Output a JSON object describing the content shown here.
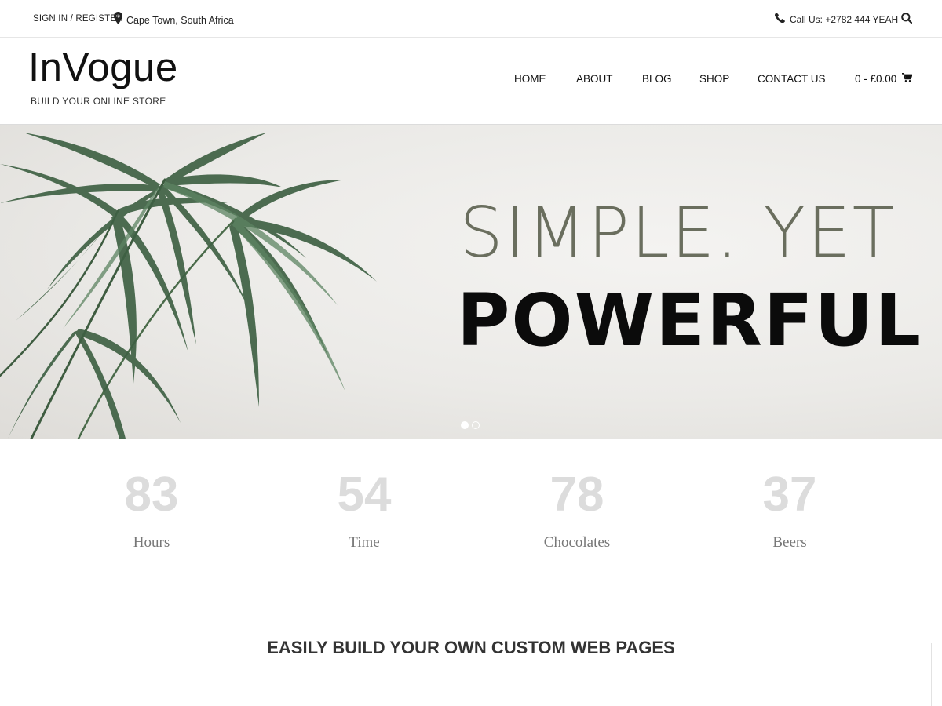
{
  "topbar": {
    "signin_label": "SIGN IN / REGISTER",
    "location": "Cape Town, South Africa",
    "call": "Call Us: +2782 444 YEAH"
  },
  "header": {
    "logo": "InVogue",
    "tagline": "BUILD YOUR ONLINE STORE",
    "nav": [
      "HOME",
      "ABOUT",
      "BLOG",
      "SHOP",
      "CONTACT US"
    ],
    "cart": "0 - £0.00"
  },
  "hero": {
    "line1": "SIMPLE. YET",
    "line2": "POWERFUL",
    "slides": 2,
    "active_slide": 1
  },
  "stats": [
    {
      "value": "83",
      "label": "Hours"
    },
    {
      "value": "54",
      "label": "Time"
    },
    {
      "value": "78",
      "label": "Chocolates"
    },
    {
      "value": "37",
      "label": "Beers"
    }
  ],
  "section": {
    "title": "EASILY BUILD YOUR OWN CUSTOM WEB PAGES"
  },
  "icons": {
    "location": "map-marker-icon",
    "phone": "phone-icon",
    "search": "search-icon",
    "cart": "shopping-cart-icon"
  },
  "colors": {
    "hero_line1": "#6a6e5e",
    "hero_line2": "#0b0b0b",
    "stat_number": "#dcdcdc",
    "stat_label": "#777777",
    "section_title": "#333333"
  }
}
